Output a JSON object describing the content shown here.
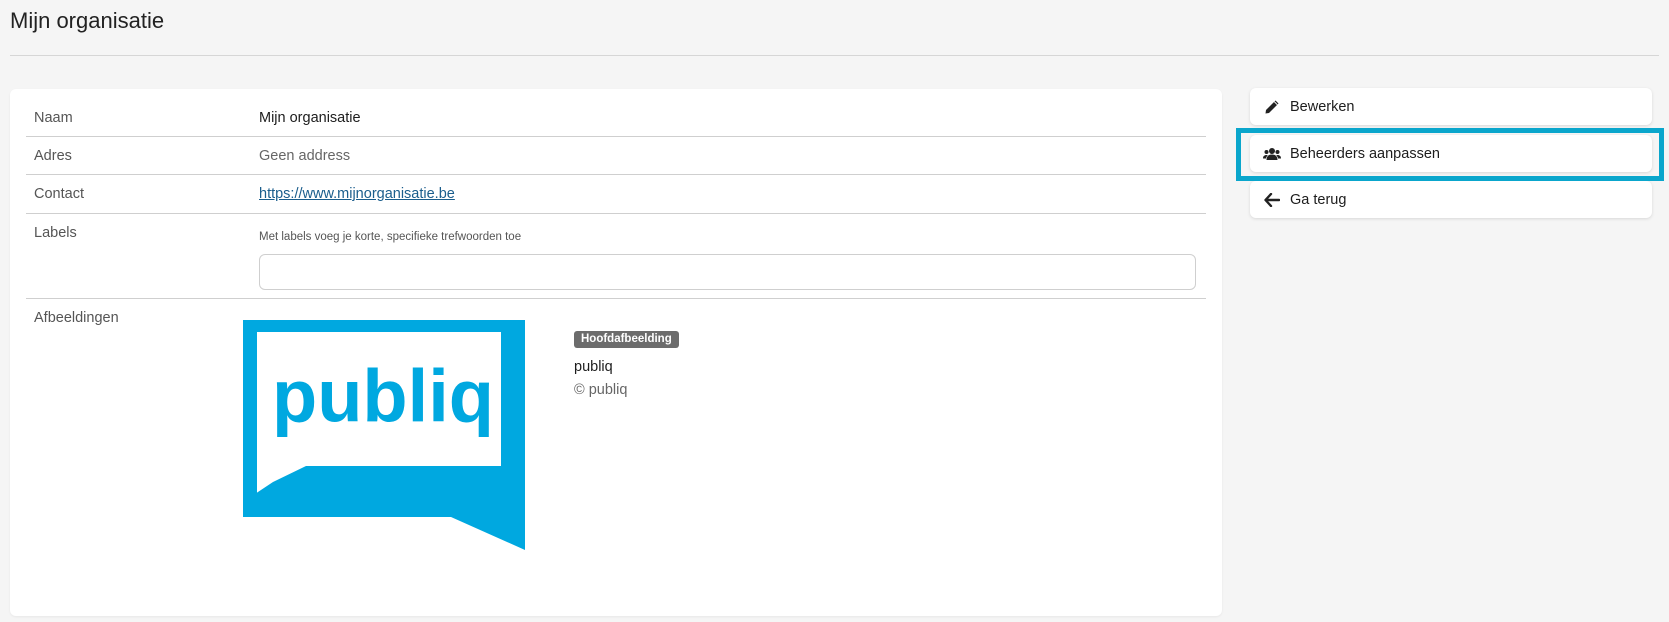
{
  "page": {
    "title": "Mijn organisatie"
  },
  "details": {
    "name_label": "Naam",
    "name_value": "Mijn organisatie",
    "address_label": "Adres",
    "address_value": "Geen address",
    "contact_label": "Contact",
    "contact_value": "https://www.mijnorganisatie.be",
    "labels_label": "Labels",
    "labels_hint": "Met labels voeg je korte, specifieke trefwoorden toe",
    "labels_input_value": "",
    "images_label": "Afbeeldingen"
  },
  "image": {
    "logo_text": "publiq",
    "badge": "Hoofdafbeelding",
    "title": "publiq",
    "copyright": "© publiq",
    "brand_color": "#00a8e0"
  },
  "actions": {
    "edit_label": "Bewerken",
    "edit_icon": "pencil-icon",
    "admins_label": "Beheerders aanpassen",
    "admins_icon": "users-icon",
    "back_label": "Ga terug",
    "back_icon": "arrow-left-icon",
    "highlight_color": "#0aa6cc"
  }
}
